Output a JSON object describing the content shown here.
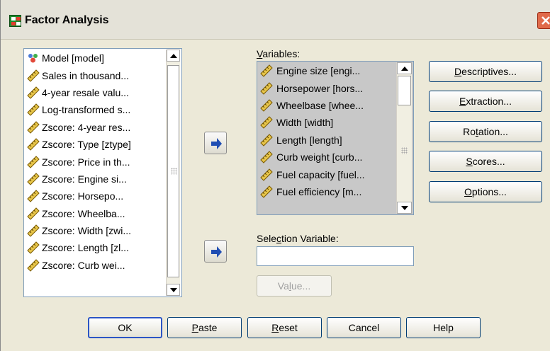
{
  "window": {
    "title": "Factor Analysis"
  },
  "source_list": {
    "items": [
      {
        "label": "Model [model]",
        "icon": "nominal-variable-icon"
      },
      {
        "label": "Sales in thousand...",
        "icon": "scale-variable-icon"
      },
      {
        "label": "4-year resale valu...",
        "icon": "scale-variable-icon"
      },
      {
        "label": "Log-transformed s...",
        "icon": "scale-variable-icon"
      },
      {
        "label": "Zscore:  4-year res...",
        "icon": "scale-variable-icon"
      },
      {
        "label": "Zscore:  Type [ztype]",
        "icon": "scale-variable-icon"
      },
      {
        "label": "Zscore:  Price in th...",
        "icon": "scale-variable-icon"
      },
      {
        "label": "Zscore:  Engine si...",
        "icon": "scale-variable-icon"
      },
      {
        "label": "Zscore:  Horsepo...",
        "icon": "scale-variable-icon"
      },
      {
        "label": "Zscore:  Wheelba...",
        "icon": "scale-variable-icon"
      },
      {
        "label": "Zscore:  Width [zwi...",
        "icon": "scale-variable-icon"
      },
      {
        "label": "Zscore:  Length [zl...",
        "icon": "scale-variable-icon"
      },
      {
        "label": "Zscore:  Curb wei...",
        "icon": "scale-variable-icon"
      }
    ]
  },
  "variables": {
    "label_prefix": "",
    "label_mnemonic": "V",
    "label_rest": "ariables:",
    "items": [
      {
        "label": "Engine size [engi...",
        "icon": "scale-variable-icon"
      },
      {
        "label": "Horsepower [hors...",
        "icon": "scale-variable-icon"
      },
      {
        "label": "Wheelbase [whee...",
        "icon": "scale-variable-icon"
      },
      {
        "label": "Width [width]",
        "icon": "scale-variable-icon"
      },
      {
        "label": "Length [length]",
        "icon": "scale-variable-icon"
      },
      {
        "label": "Curb weight [curb...",
        "icon": "scale-variable-icon"
      },
      {
        "label": "Fuel capacity [fuel...",
        "icon": "scale-variable-icon"
      },
      {
        "label": "Fuel efficiency [m...",
        "icon": "scale-variable-icon"
      }
    ]
  },
  "selection_variable": {
    "label_prefix": "Sele",
    "label_mnemonic": "c",
    "label_rest": "tion Variable:",
    "value": "",
    "value_button": {
      "prefix": "Va",
      "mnemonic": "l",
      "rest": "ue..."
    }
  },
  "side_buttons": {
    "descriptives": {
      "prefix": "",
      "mnemonic": "D",
      "rest": "escriptives..."
    },
    "extraction": {
      "prefix": "",
      "mnemonic": "E",
      "rest": "xtraction..."
    },
    "rotation": {
      "prefix": "Ro",
      "mnemonic": "t",
      "rest": "ation..."
    },
    "scores": {
      "prefix": "",
      "mnemonic": "S",
      "rest": "cores..."
    },
    "options": {
      "prefix": "",
      "mnemonic": "O",
      "rest": "ptions..."
    }
  },
  "bottom_buttons": {
    "ok": "OK",
    "paste": {
      "prefix": "",
      "mnemonic": "P",
      "rest": "aste"
    },
    "reset": {
      "prefix": "",
      "mnemonic": "R",
      "rest": "eset"
    },
    "cancel": "Cancel",
    "help": "Help"
  },
  "colors": {
    "dialog_bg": "#ece9d8",
    "list_border": "#7f9db9",
    "selected_list_bg": "#c8c8c8",
    "arrow_button_icon": "#1f4db3",
    "default_button_border": "#2b55c5"
  }
}
